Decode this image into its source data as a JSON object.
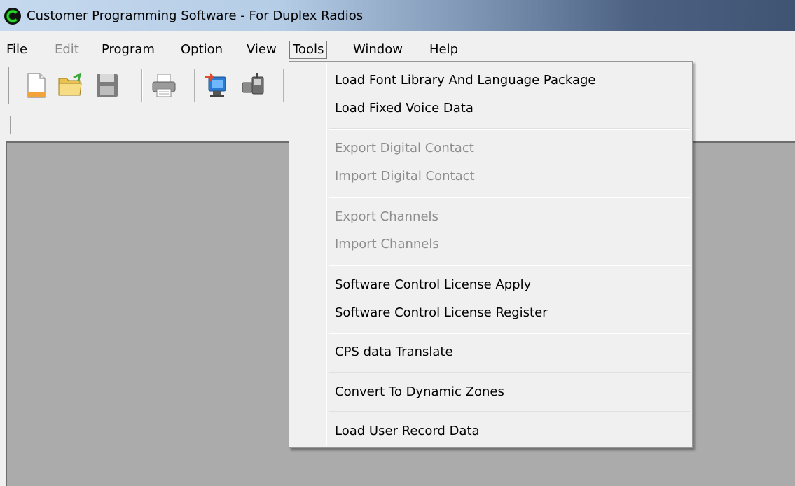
{
  "window": {
    "title": "Customer Programming Software - For Duplex Radios"
  },
  "menubar": {
    "items": [
      {
        "label": "File",
        "enabled": true
      },
      {
        "label": "Edit",
        "enabled": false
      },
      {
        "label": "Program",
        "enabled": true
      },
      {
        "label": "Option",
        "enabled": true
      },
      {
        "label": "View",
        "enabled": true
      },
      {
        "label": "Tools",
        "enabled": true,
        "active": true
      },
      {
        "label": "Window",
        "enabled": true
      },
      {
        "label": "Help",
        "enabled": true
      }
    ]
  },
  "toolbar": {
    "buttons": [
      {
        "icon": "new-file-icon"
      },
      {
        "icon": "open-folder-icon"
      },
      {
        "icon": "save-disk-icon"
      },
      {
        "icon": "printer-icon"
      },
      {
        "icon": "read-radio-icon"
      },
      {
        "icon": "write-radio-icon"
      }
    ]
  },
  "tools_menu": {
    "groups": [
      [
        {
          "label": "Load Font Library And Language Package",
          "enabled": true
        },
        {
          "label": "Load Fixed Voice Data",
          "enabled": true
        }
      ],
      [
        {
          "label": "Export Digital Contact",
          "enabled": false
        },
        {
          "label": "Import Digital Contact",
          "enabled": false
        }
      ],
      [
        {
          "label": "Export Channels",
          "enabled": false
        },
        {
          "label": "Import Channels",
          "enabled": false
        }
      ],
      [
        {
          "label": "Software Control License Apply",
          "enabled": true
        },
        {
          "label": "Software Control License Register",
          "enabled": true
        }
      ],
      [
        {
          "label": "CPS data Translate",
          "enabled": true
        }
      ],
      [
        {
          "label": "Convert To Dynamic Zones",
          "enabled": true
        }
      ],
      [
        {
          "label": "Load User Record Data",
          "enabled": true
        }
      ]
    ]
  },
  "colors": {
    "menu_background": "#f0f0f0",
    "workspace": "#ababab",
    "disabled_text": "#8d8d8d",
    "app_icon_green": "#1e9e1e"
  }
}
